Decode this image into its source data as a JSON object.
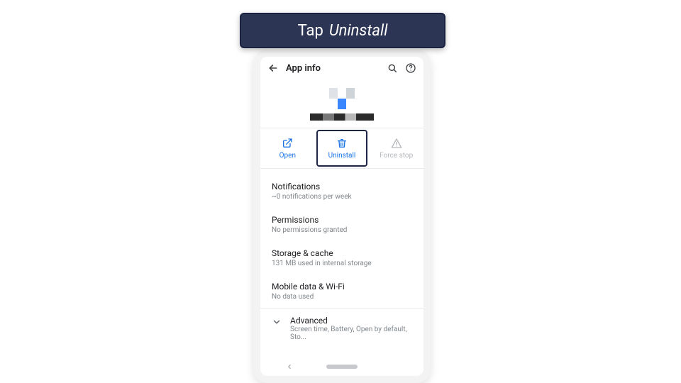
{
  "banner": {
    "verb": "Tap",
    "target": "Uninstall"
  },
  "appbar": {
    "title": "App info"
  },
  "actions": {
    "open": "Open",
    "uninstall": "Uninstall",
    "forcestop": "Force stop"
  },
  "settings": {
    "notifications": {
      "title": "Notifications",
      "sub": "~0 notifications per week"
    },
    "permissions": {
      "title": "Permissions",
      "sub": "No permissions granted"
    },
    "storage": {
      "title": "Storage & cache",
      "sub": "131 MB used in internal storage"
    },
    "data": {
      "title": "Mobile data & Wi-Fi",
      "sub": "No data used"
    },
    "advanced": {
      "title": "Advanced",
      "sub": "Screen time, Battery, Open by default, Sto..."
    }
  }
}
